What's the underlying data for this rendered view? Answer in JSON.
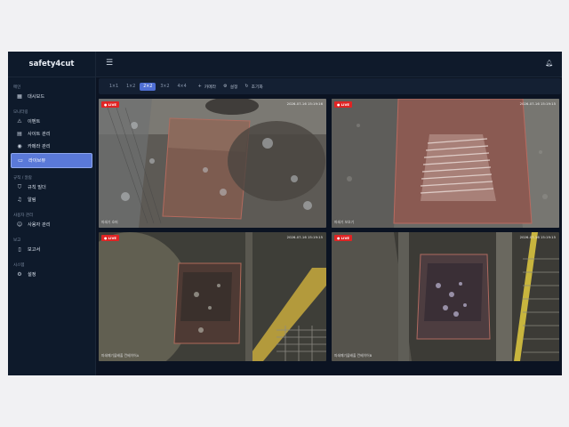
{
  "app": {
    "brand": "safety4cut"
  },
  "sidebar": {
    "sections": [
      {
        "label": "메인",
        "items": [
          {
            "label": "대시보드",
            "icon": "dashboard-icon"
          }
        ]
      },
      {
        "label": "모니터링",
        "items": [
          {
            "label": "이벤트",
            "icon": "warning-icon"
          },
          {
            "label": "사이트 관리",
            "icon": "site-icon"
          },
          {
            "label": "카메라 관리",
            "icon": "camera-icon"
          },
          {
            "label": "라이브뷰",
            "icon": "video-icon",
            "active": true
          }
        ]
      },
      {
        "label": "규칙 / 알람",
        "items": [
          {
            "label": "규칙 빌더",
            "icon": "shield-icon"
          },
          {
            "label": "알림",
            "icon": "bell-icon"
          }
        ]
      },
      {
        "label": "사용자 관리",
        "items": [
          {
            "label": "사용자 관리",
            "icon": "users-icon"
          }
        ]
      },
      {
        "label": "보고",
        "items": [
          {
            "label": "보고서",
            "icon": "report-icon"
          }
        ]
      },
      {
        "label": "시스템",
        "items": [
          {
            "label": "설정",
            "icon": "gear-icon"
          }
        ]
      }
    ]
  },
  "toolbar": {
    "layouts": [
      "1×1",
      "1×2",
      "2×2",
      "3×2",
      "4×4"
    ],
    "selected_layout": "2×2",
    "actions": [
      {
        "label": "카메라",
        "icon": "plus-icon"
      },
      {
        "label": "설정",
        "icon": "gear-icon"
      },
      {
        "label": "초기화",
        "icon": "reset-icon"
      }
    ]
  },
  "cameras": [
    {
      "live": "● LIVE",
      "timestamp": "2026-07-16 15:19:16",
      "name": "파쇄기 호퍼"
    },
    {
      "live": "● LIVE",
      "timestamp": "2026-07-16 15:19:15",
      "name": "파쇄기 보호기"
    },
    {
      "live": "● LIVE",
      "timestamp": "2026-07-16 15:19:15",
      "name": "파쇄폐기물배출 컨베이어A"
    },
    {
      "live": "● LIVE",
      "timestamp": "2026-07-16 15:19:15",
      "name": "파쇄폐기물배출 컨베이어B"
    }
  ],
  "colors": {
    "accent": "#4f6fd4",
    "live": "#e02424",
    "background": "#0b1322",
    "sidebar": "#0e1a2b"
  }
}
